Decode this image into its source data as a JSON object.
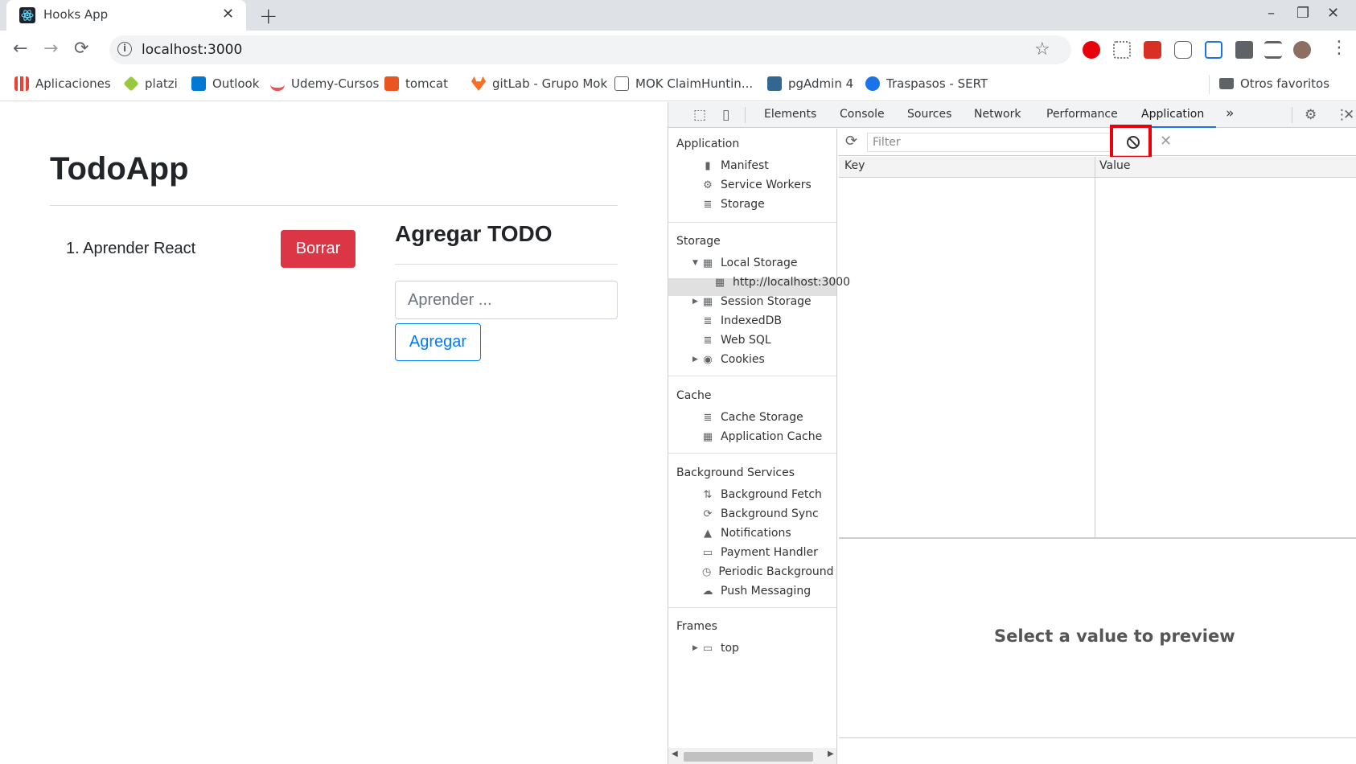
{
  "browser": {
    "tab_title": "Hooks App",
    "tab_close": "✕",
    "new_tab": "+",
    "window_controls": {
      "minimize": "–",
      "restore": "❐",
      "close": "✕"
    },
    "url": "localhost:3000",
    "nav_icons": {
      "back": "←",
      "forward": "→",
      "reload": "⟳",
      "star": "☆",
      "menu": "⋮"
    },
    "info_icon": "i",
    "bookmarks": [
      {
        "label": "Aplicaciones",
        "icon": "apps-grid-icon",
        "color": "#ea4335"
      },
      {
        "label": "platzi",
        "icon": "platzi-icon",
        "color": "#98ca3f"
      },
      {
        "label": "Outlook",
        "icon": "outlook-icon",
        "color": "#0078d4"
      },
      {
        "label": "Udemy-Cursos",
        "icon": "udemy-icon",
        "color": "#ec5252"
      },
      {
        "label": "tomcat",
        "icon": "ubuntu-icon",
        "color": "#e95420"
      },
      {
        "label": "gitLab - Grupo Mok",
        "icon": "gitlab-icon",
        "color": "#fc6d26"
      },
      {
        "label": "MOK ClaimHuntin...",
        "icon": "image-icon",
        "color": "#5f6368"
      },
      {
        "label": "pgAdmin 4",
        "icon": "pgadmin-icon",
        "color": "#336791"
      },
      {
        "label": "Traspasos - SERT",
        "icon": "circle-logo-icon",
        "color": "#1a73e8"
      }
    ],
    "other_bookmarks": "Otros favoritos"
  },
  "app": {
    "title": "TodoApp",
    "todos": [
      {
        "label": "1. Aprender React",
        "delete_label": "Borrar"
      }
    ],
    "form": {
      "title": "Agregar TODO",
      "placeholder": "Aprender ...",
      "submit_label": "Agregar"
    }
  },
  "devtools": {
    "tabs": [
      "Elements",
      "Console",
      "Sources",
      "Network",
      "Performance",
      "Application"
    ],
    "active_tab": "Application",
    "more_tabs": "»",
    "sidebar": {
      "application_header": "Application",
      "application_items": [
        "Manifest",
        "Service Workers",
        "Storage"
      ],
      "storage_header": "Storage",
      "storage_items": [
        "Local Storage",
        "http://localhost:3000",
        "Session Storage",
        "IndexedDB",
        "Web SQL",
        "Cookies"
      ],
      "cache_header": "Cache",
      "cache_items": [
        "Cache Storage",
        "Application Cache"
      ],
      "background_header": "Background Services",
      "background_items": [
        "Background Fetch",
        "Background Sync",
        "Notifications",
        "Payment Handler",
        "Periodic Background Sync",
        "Push Messaging"
      ],
      "frames_header": "Frames",
      "frames_items": [
        "top"
      ]
    },
    "storage_view": {
      "filter_placeholder": "Filter",
      "columns": [
        "Key",
        "Value"
      ],
      "rows": [],
      "preview_text": "Select a value to preview"
    }
  }
}
